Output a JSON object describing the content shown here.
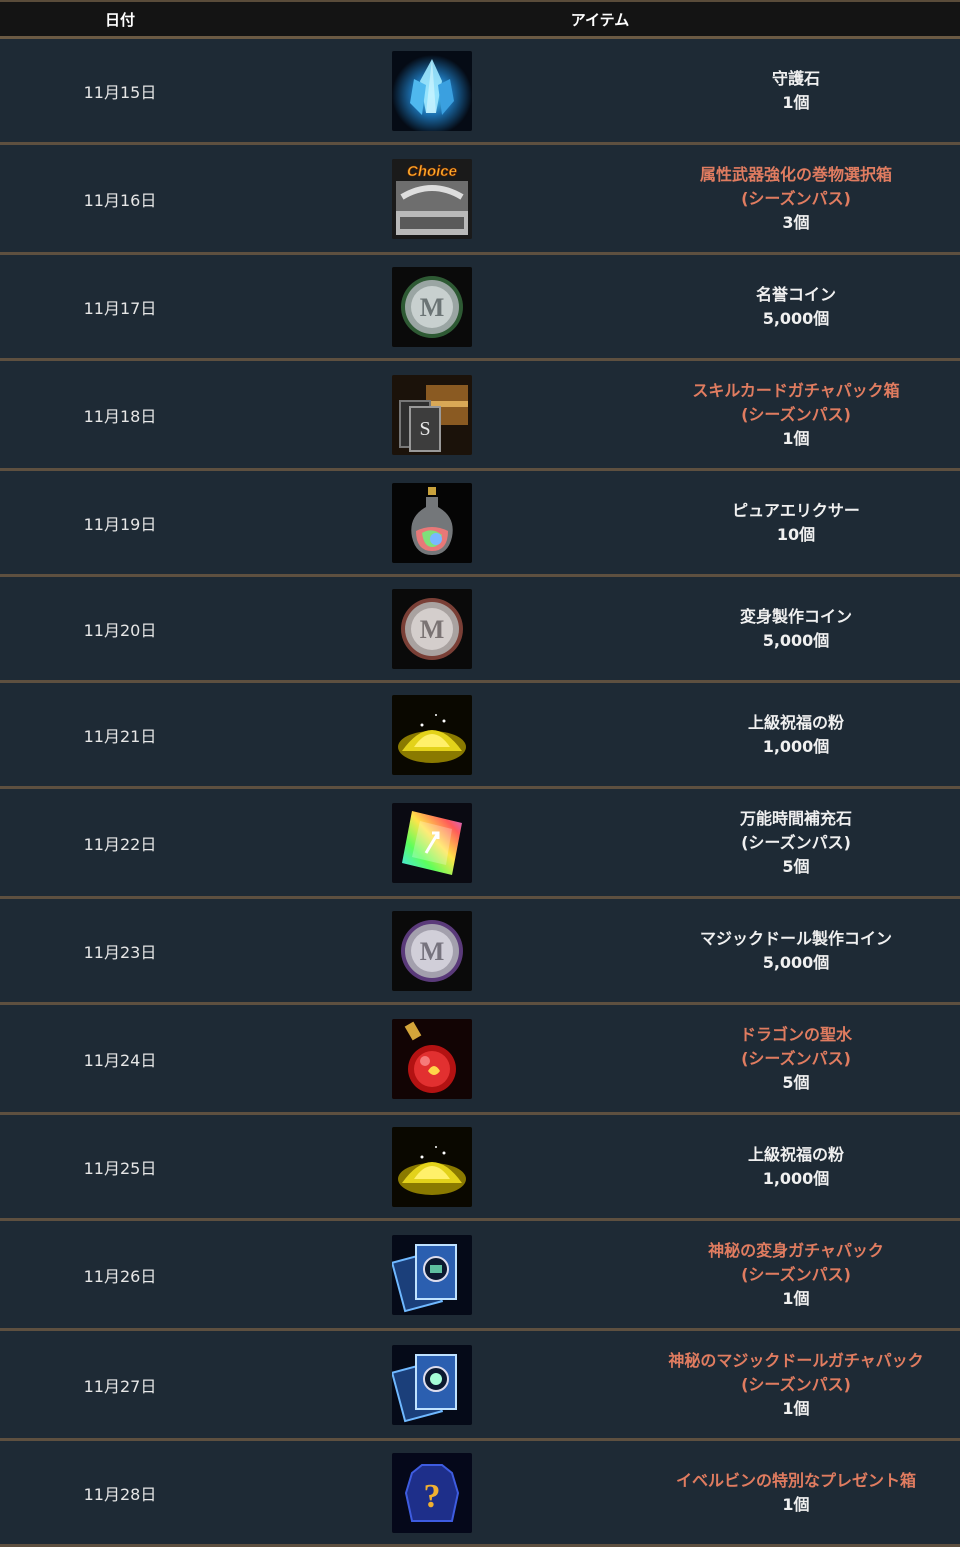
{
  "header": {
    "date_label": "日付",
    "item_label": "アイテム"
  },
  "rows": [
    {
      "date": "11月15日",
      "name": "守護石",
      "season": "",
      "qty": "1個",
      "special": false,
      "icon": "blue-crystal-icon"
    },
    {
      "date": "11月16日",
      "name": "属性武器強化の巻物選択箱",
      "season": "(シーズンパス)",
      "qty": "3個",
      "special": true,
      "icon": "choice-scroll-box-icon",
      "icon_text": "Choice"
    },
    {
      "date": "11月17日",
      "name": "名誉コイン",
      "season": "",
      "qty": "5,000個",
      "special": false,
      "icon": "green-coin-icon"
    },
    {
      "date": "11月18日",
      "name": "スキルカードガチャパック箱",
      "season": "(シーズンパス)",
      "qty": "1個",
      "special": true,
      "icon": "skill-card-chest-icon"
    },
    {
      "date": "11月19日",
      "name": "ピュアエリクサー",
      "season": "",
      "qty": "10個",
      "special": false,
      "icon": "elixir-flask-icon"
    },
    {
      "date": "11月20日",
      "name": "変身製作コイン",
      "season": "",
      "qty": "5,000個",
      "special": false,
      "icon": "bronze-coin-icon"
    },
    {
      "date": "11月21日",
      "name": "上級祝福の粉",
      "season": "",
      "qty": "1,000個",
      "special": false,
      "icon": "gold-powder-icon"
    },
    {
      "date": "11月22日",
      "name": "万能時間補充石",
      "season": "(シーズンパス)",
      "qty": "5個",
      "special": false,
      "icon": "rainbow-gem-icon"
    },
    {
      "date": "11月23日",
      "name": "マジックドール製作コイン",
      "season": "",
      "qty": "5,000個",
      "special": false,
      "icon": "purple-coin-icon"
    },
    {
      "date": "11月24日",
      "name": "ドラゴンの聖水",
      "season": "(シーズンパス)",
      "qty": "5個",
      "special": true,
      "icon": "red-potion-icon"
    },
    {
      "date": "11月25日",
      "name": "上級祝福の粉",
      "season": "",
      "qty": "1,000個",
      "special": false,
      "icon": "gold-powder-icon"
    },
    {
      "date": "11月26日",
      "name": "神秘の変身ガチャパック",
      "season": "(シーズンパス)",
      "qty": "1個",
      "special": true,
      "icon": "transform-card-pack-icon"
    },
    {
      "date": "11月27日",
      "name": "神秘のマジックドールガチャパック",
      "season": "(シーズンパス)",
      "qty": "1個",
      "special": true,
      "icon": "doll-card-pack-icon"
    },
    {
      "date": "11月28日",
      "name": "イベルビンの特別なプレゼント箱",
      "season": "",
      "qty": "1個",
      "special": true,
      "icon": "mystery-gift-icon"
    }
  ],
  "colors": {
    "background": "#1e2a35",
    "header_bg": "#141414",
    "divider": "#5e5040",
    "special_text": "#e07c60"
  }
}
